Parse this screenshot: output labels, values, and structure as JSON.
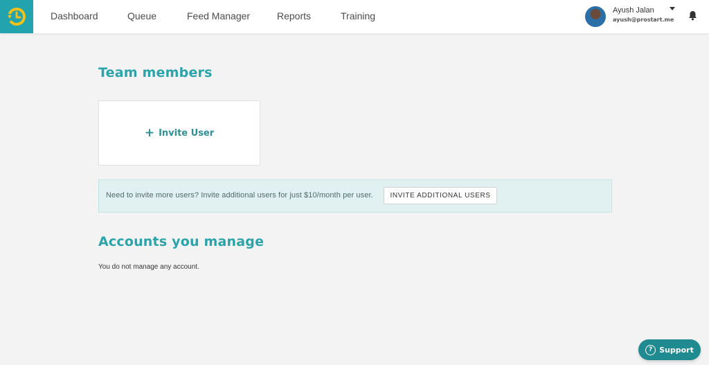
{
  "brand": {
    "accent": "#23a3ad",
    "logo_accent": "#f2c21b",
    "title_color": "#2aa4aa"
  },
  "nav": {
    "items": [
      {
        "label": "Dashboard"
      },
      {
        "label": "Queue"
      },
      {
        "label": "Feed Manager"
      },
      {
        "label": "Reports"
      },
      {
        "label": "Training"
      }
    ]
  },
  "user": {
    "name": "Ayush Jalan",
    "email": "ayush@prostart.me"
  },
  "team": {
    "title": "Team members",
    "invite_label": "Invite User"
  },
  "banner": {
    "text": "Need to invite more users? Invite additional users for just $10/month per user.",
    "button_label": "INVITE ADDITIONAL USERS"
  },
  "accounts": {
    "title": "Accounts you manage",
    "empty_text": "You do not manage any account."
  },
  "support": {
    "label": "Support",
    "icon": "question-circle-icon"
  }
}
